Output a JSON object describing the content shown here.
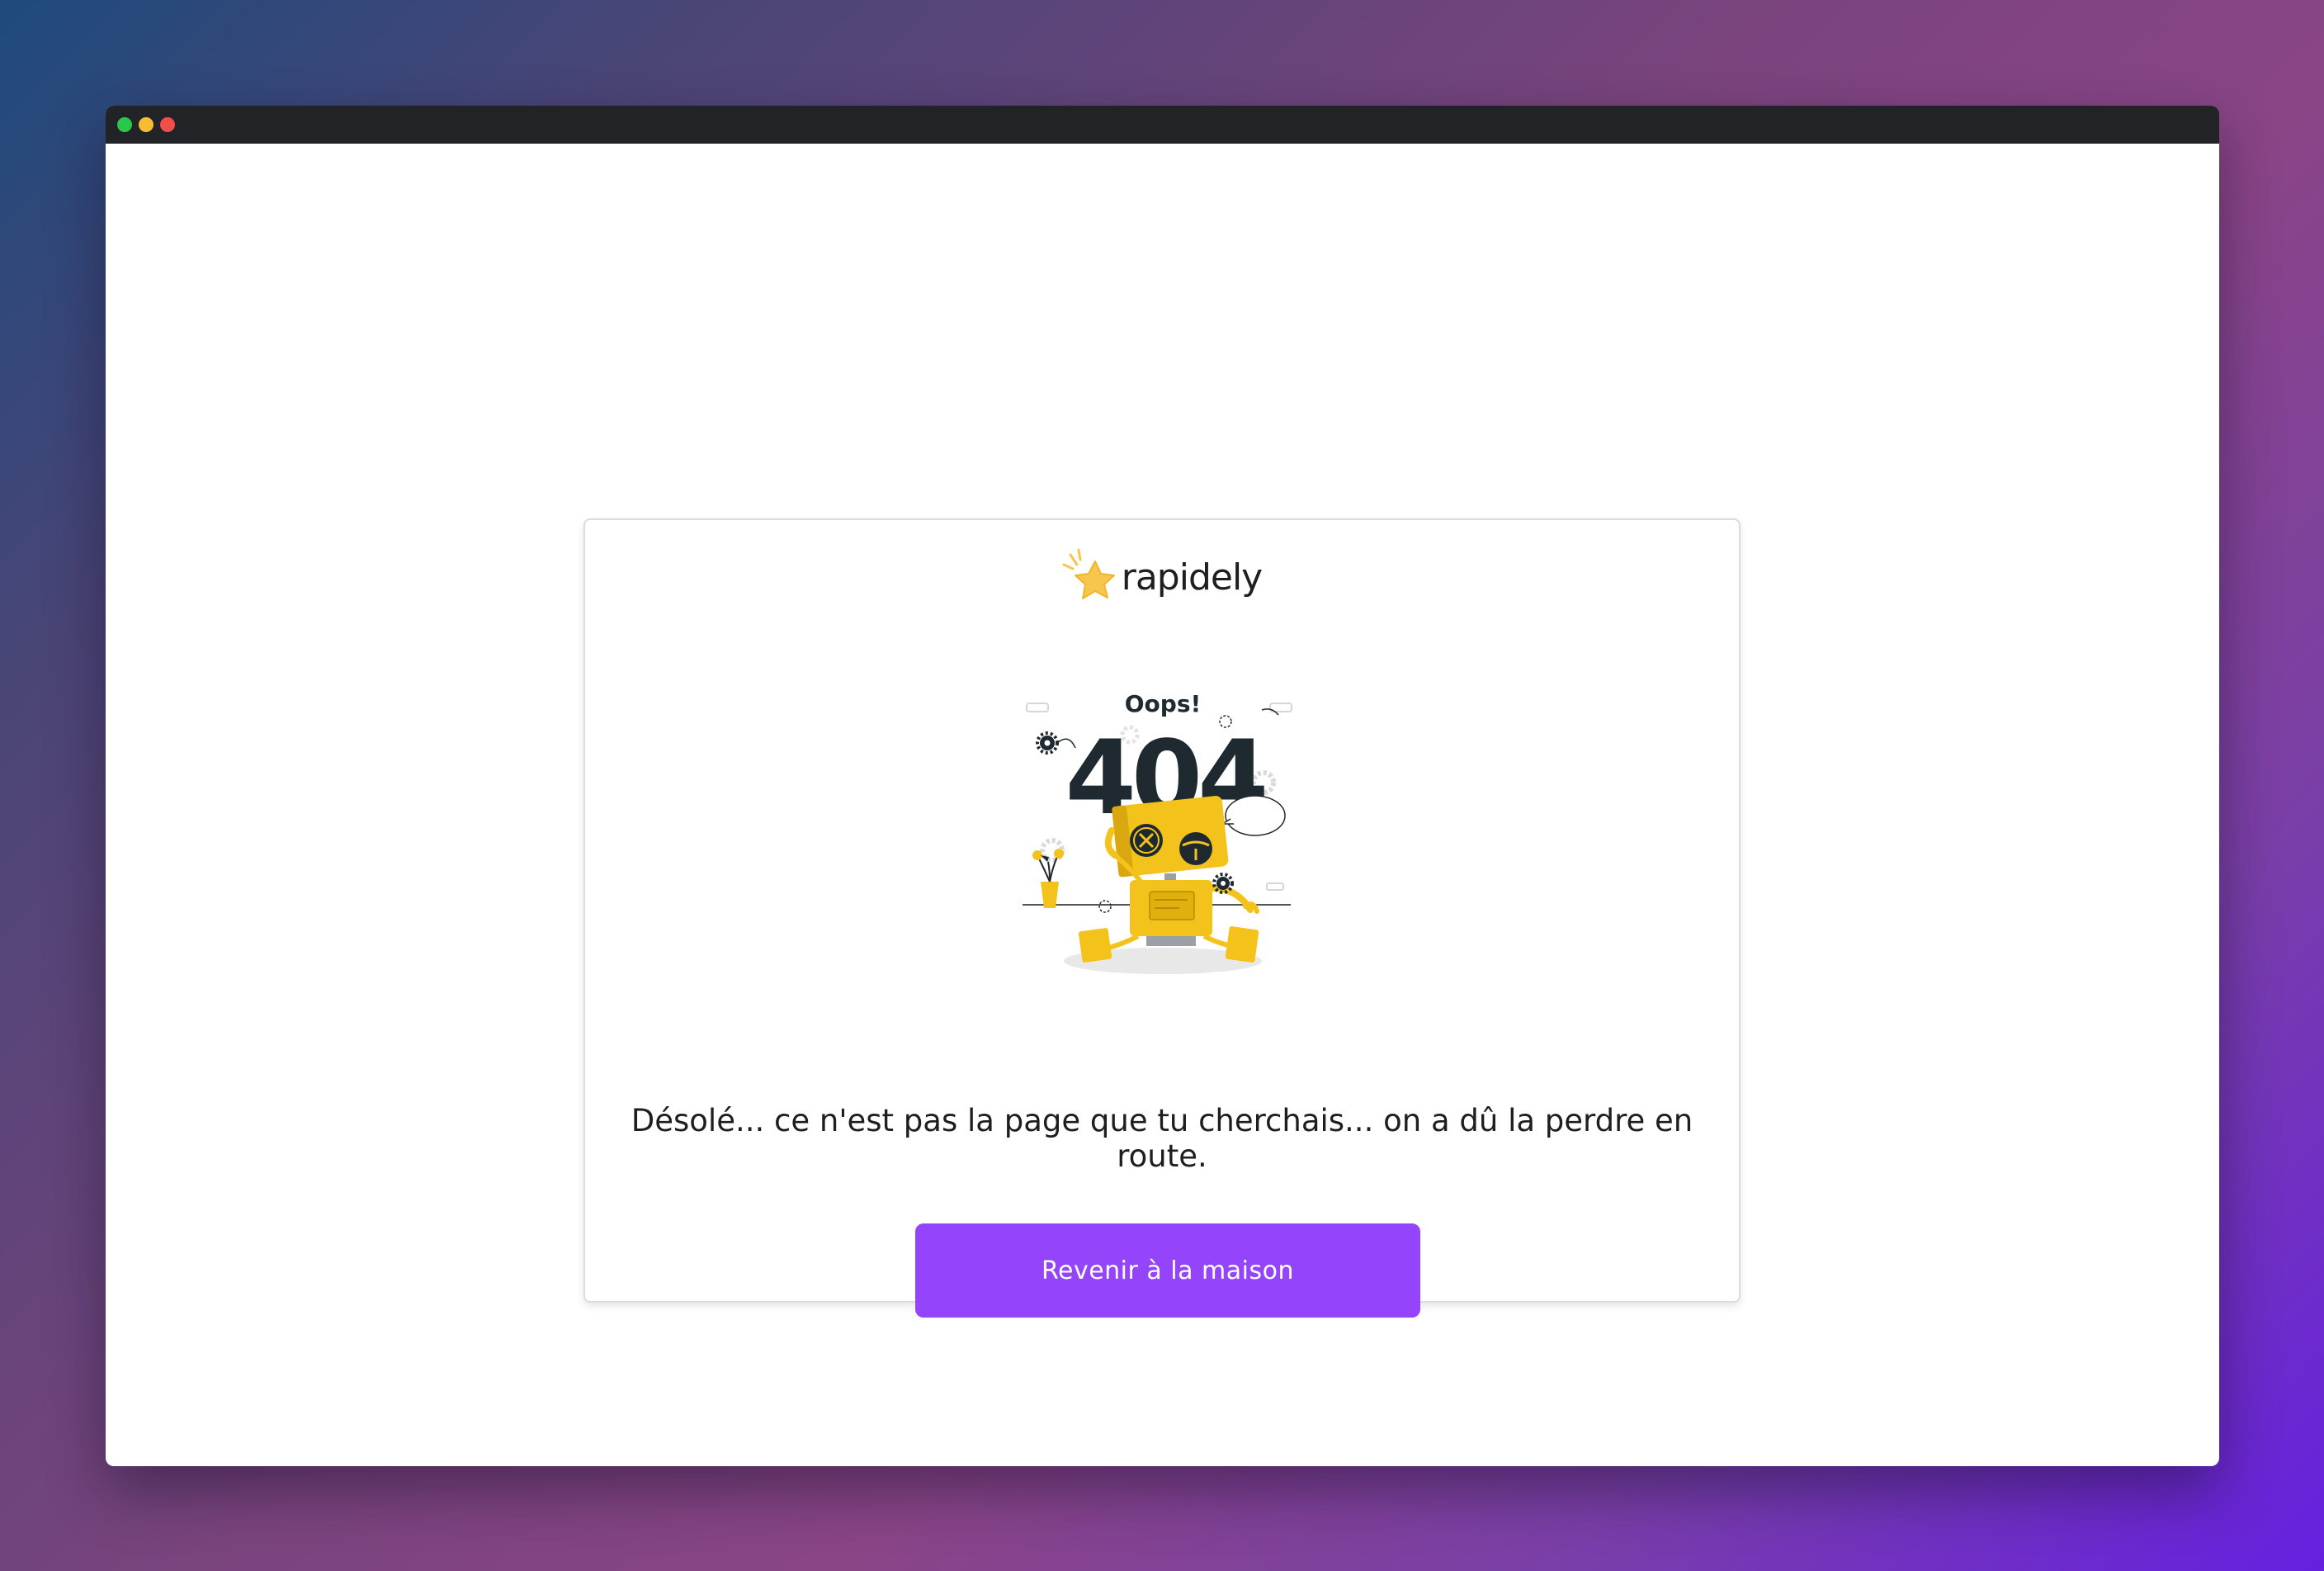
{
  "window": {
    "traffic_lights": [
      "#2ac84a",
      "#f5bd2f",
      "#ef4e4a"
    ]
  },
  "logo": {
    "text": "rapidely",
    "icon": "star-icon",
    "icon_color": "#f6c64d"
  },
  "illustration": {
    "heading": "Oops!",
    "code": "404",
    "icon": "broken-robot-illustration",
    "accent_color": "#f4c31b"
  },
  "message": "Désolé... ce n'est pas la page que tu cherchais... on a dû la perdre en route.",
  "cta": {
    "label": "Revenir à la maison",
    "color": "#9445fc"
  }
}
